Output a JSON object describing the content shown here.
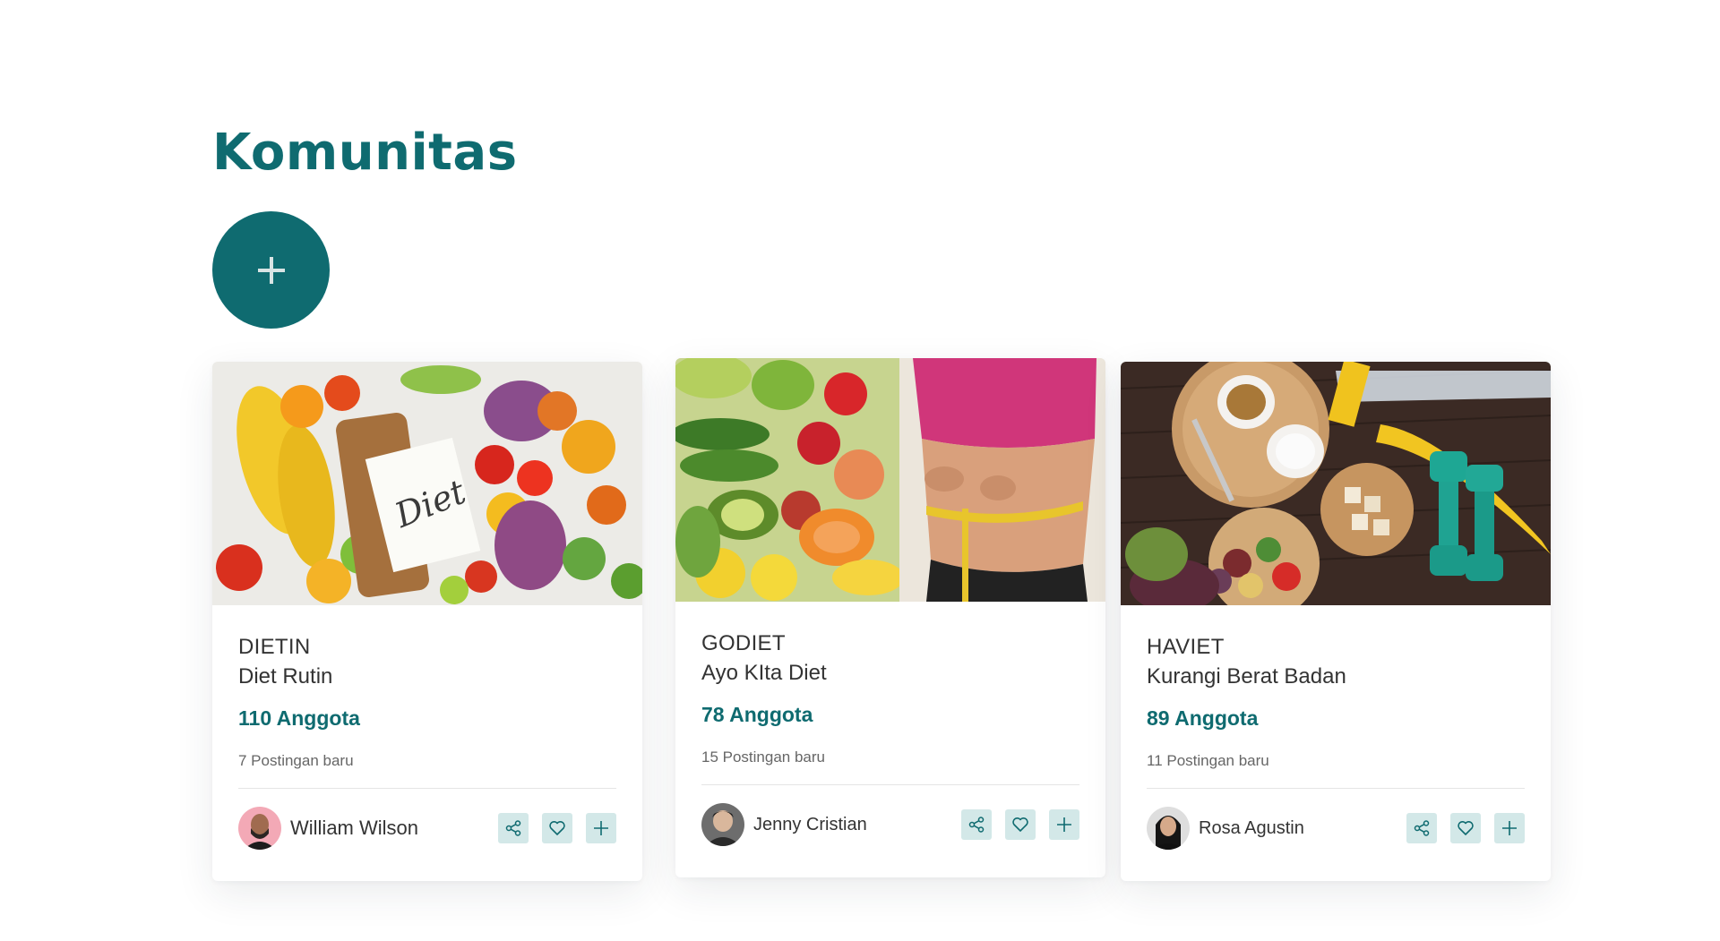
{
  "page": {
    "title": "Komunitas"
  },
  "add_button": {
    "icon": "plus-icon"
  },
  "colors": {
    "accent": "#0f6b70",
    "action_bg": "#d3e8e8"
  },
  "cards": [
    {
      "code": "DIETIN",
      "name": "Diet Rutin",
      "members": "110 Anggota",
      "posts": "7 Postingan baru",
      "owner": "William Wilson",
      "image": "vegetables-diet-notebook",
      "actions": [
        "share-icon",
        "heart-icon",
        "plus-icon"
      ]
    },
    {
      "code": "GODIET",
      "name": "Ayo KIta Diet",
      "members": "78 Anggota",
      "posts": "15 Postingan baru",
      "owner": "Jenny Cristian",
      "image": "fruits-measuring-waist",
      "actions": [
        "share-icon",
        "heart-icon",
        "plus-icon"
      ]
    },
    {
      "code": "HAVIET",
      "name": "Kurangi Berat Badan",
      "members": "89 Anggota",
      "posts": "11 Postingan baru",
      "owner": "Rosa Agustin",
      "image": "healthy-food-dumbbells",
      "actions": [
        "share-icon",
        "heart-icon",
        "plus-icon"
      ]
    }
  ]
}
